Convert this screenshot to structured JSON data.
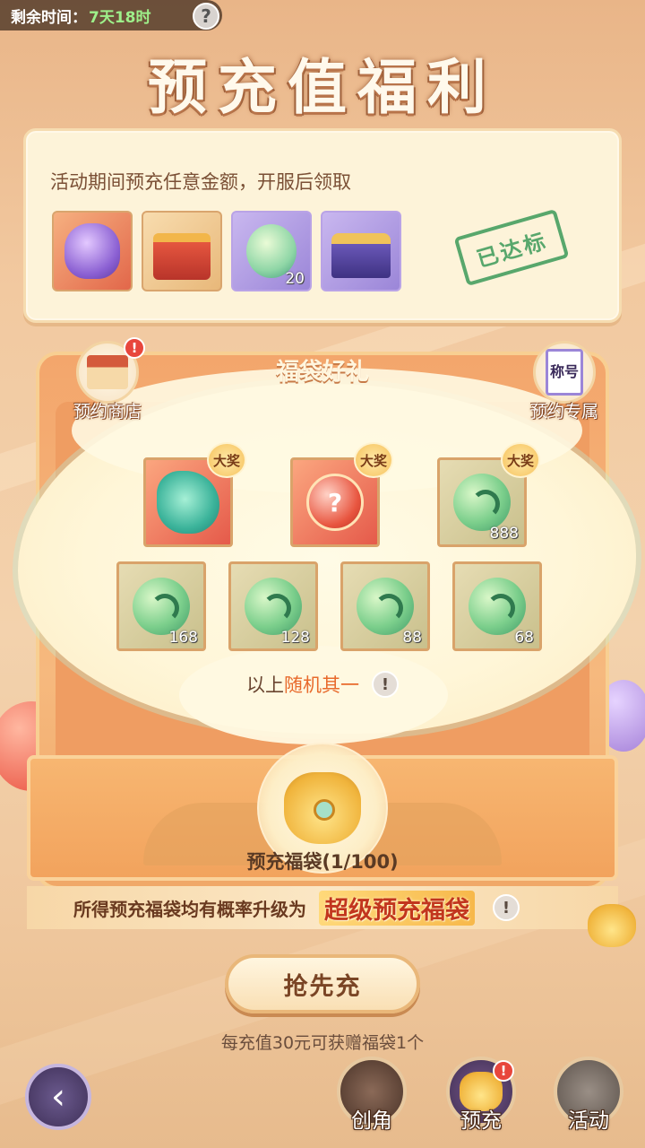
{
  "header": {
    "timer_label": "剩余时间：",
    "timer_value": "7天18时",
    "help_icon": "question-icon",
    "title": "预充值福利"
  },
  "prerecharge": {
    "description": "活动期间预充任意金额，开服后领取",
    "rewards": [
      {
        "icon": "purple-pouch-icon",
        "count": ""
      },
      {
        "icon": "gift-box-icon",
        "count": ""
      },
      {
        "icon": "potion-bottle-icon",
        "count": "20"
      },
      {
        "icon": "treasure-chest-icon",
        "count": ""
      }
    ],
    "stamp": "已达标"
  },
  "lucky_bag": {
    "section_title": "福袋好礼",
    "left_button": {
      "label": "预约商店",
      "badge": "!"
    },
    "right_button": {
      "label": "预约专属",
      "scroll_text": "称号"
    },
    "grand_badge": "大奖",
    "grand_prizes": [
      {
        "icon": "dragon-mount-icon",
        "count": ""
      },
      {
        "icon": "mystery-orb-icon",
        "count": ""
      },
      {
        "icon": "jade-gem-icon",
        "count": "888"
      }
    ],
    "prizes": [
      {
        "icon": "jade-gem-icon",
        "count": "168"
      },
      {
        "icon": "jade-gem-icon",
        "count": "128"
      },
      {
        "icon": "jade-gem-icon",
        "count": "88"
      },
      {
        "icon": "jade-gem-icon",
        "count": "68"
      }
    ],
    "random_prefix": "以上",
    "random_highlight": "随机其一",
    "bag_label": "预充福袋(1/100)",
    "upgrade_text": "所得预充福袋均有概率升级为",
    "upgrade_highlight": "超级预充福袋"
  },
  "cta": {
    "label": "抢先充",
    "note": "每充值30元可获赠福袋1个"
  },
  "bottom_nav": {
    "back_icon": "back-arrow-icon",
    "items": [
      {
        "label": "创角",
        "icon": "hero-portrait-icon"
      },
      {
        "label": "预充",
        "icon": "lucky-bag-icon",
        "badge": "!"
      },
      {
        "label": "活动",
        "icon": "fist-icon"
      }
    ]
  },
  "colors": {
    "accent_orange": "#e86a2c",
    "stamp_green": "#3c9a5a",
    "timer_green": "#9ef08a",
    "badge_red": "#e8463c"
  }
}
